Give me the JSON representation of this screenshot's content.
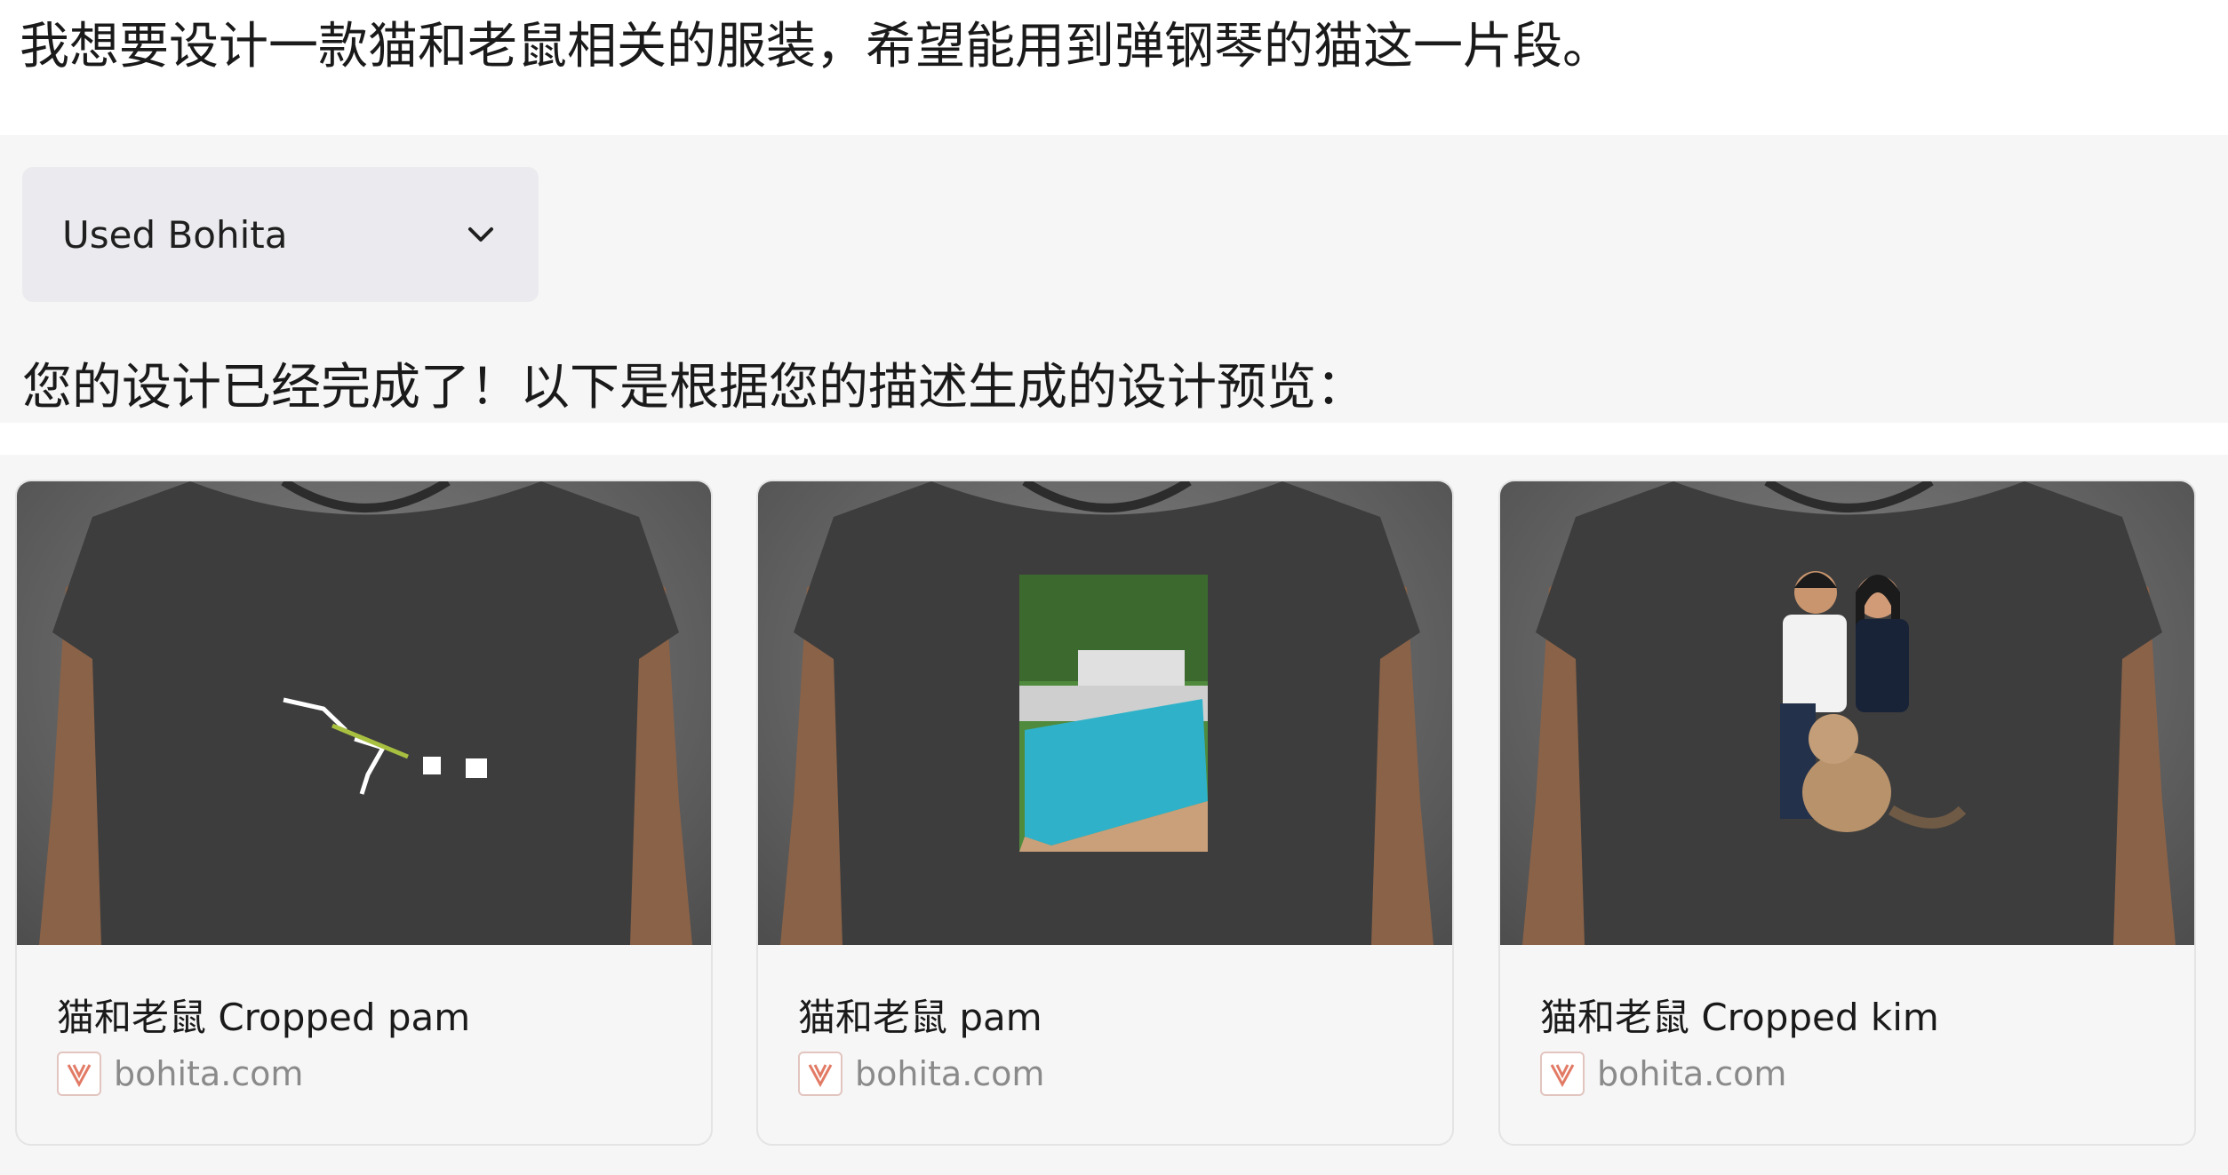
{
  "conversation": {
    "user_message": "我想要设计一款猫和老鼠相关的服装，希望能用到弹钢琴的猫这一片段。",
    "tool_pill": {
      "label": "Used Bohita",
      "icon": "chevron-down-icon"
    },
    "assistant_message": "您的设计已经完成了！以下是根据您的描述生成的设计预览："
  },
  "cards": [
    {
      "title": "猫和老鼠 Cropped pam",
      "source": "bohita.com",
      "image": "tshirt-with-cropped-cat-print"
    },
    {
      "title": "猫和老鼠  pam",
      "source": "bohita.com",
      "image": "tshirt-with-pool-photo-print"
    },
    {
      "title": "猫和老鼠 Cropped kim",
      "source": "bohita.com",
      "image": "tshirt-with-couple-and-cat-print"
    }
  ],
  "colors": {
    "background": "#ffffff",
    "panel": "#f6f6f6",
    "pill": "#ebebef",
    "tshirt": "#3d3d3d",
    "source_text": "#8a8a8a"
  }
}
